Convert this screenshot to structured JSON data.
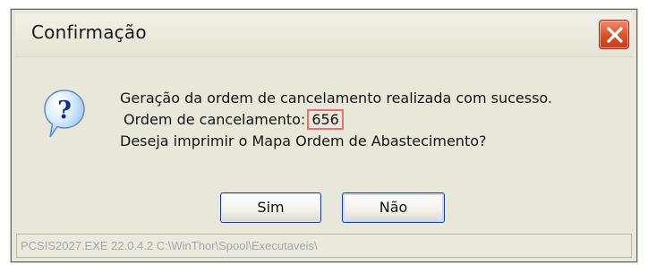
{
  "window": {
    "title": "Confirmação",
    "close_icon": "close-icon"
  },
  "message": {
    "icon": "question-icon",
    "line1": "Geração da ordem de cancelamento realizada com sucesso.",
    "line2_label": "Ordem de cancelamento:",
    "order_number": "656",
    "line3": "Deseja imprimir o Mapa Ordem de Abastecimento?"
  },
  "buttons": {
    "yes_label": "Sim",
    "no_label": "Não"
  },
  "statusbar": {
    "text": "PCSIS2027.EXE 22.0.4.2 C:\\WinThor\\Spool\\Executaveis\\"
  },
  "colors": {
    "highlight_box": "#e8726a",
    "close_button": "#d8502d",
    "button_border": "#1a3f8f"
  }
}
